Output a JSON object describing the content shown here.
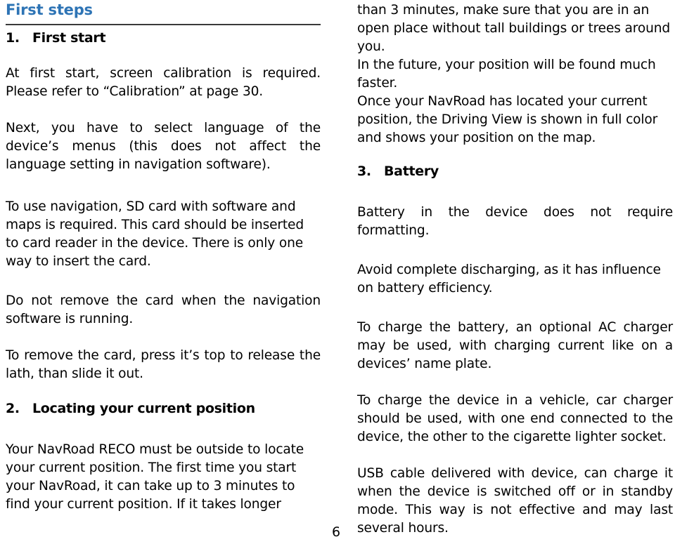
{
  "document": {
    "running_head": "First steps",
    "page_number": "6",
    "accent_color": "#2e74b5",
    "rule_color": "#3a3a3a",
    "text_color": "#000000"
  },
  "left_column": {
    "section_1": {
      "number": "1.",
      "title": "First start"
    },
    "paragraphs": {
      "p1": "At first start, screen calibration is required. Please refer to “Calibration” at page 30.",
      "p2": "Next, you have to select language of the device’s menus (this does not affect the language setting in navigation software).",
      "p3": "To use navigation, SD card with software and maps is required. This card should be inserted to card reader in the device. There is only one way to insert the card.",
      "p4": "Do not remove the card when the navigation software is running.",
      "p5": "To remove the card, press it’s top to release the lath, than slide it out.",
      "p6": "Your NavRoad RECO must be outside to locate your current position. The first time you start your NavRoad, it can take up to 3 minutes to find your current position. If it takes longer"
    },
    "section_2": {
      "number": "2.",
      "title": "Locating your current position"
    }
  },
  "right_column": {
    "paragraphs": {
      "p1": "than 3 minutes, make sure that you are in an open place without tall buildings or trees around you.",
      "p2": "In the future, your position will be found much faster.",
      "p3": "Once your NavRoad has located your current position, the Driving View is shown in full color and shows your position on the map.",
      "p4": "Battery in the device does not require formatting.",
      "p5": "Avoid complete discharging, as it has influence on battery efficiency.",
      "p6": "To charge the battery, an optional AC charger may be used, with charging current like on a devices’ name plate.",
      "p7": "To charge the device in a vehicle, car charger should be used, with one end connected to the device, the other to the cigarette lighter socket.",
      "p8": "USB cable delivered with device, can charge it when the device is switched off or in standby mode. This way is not effective and may last several hours."
    },
    "section_3": {
      "number": "3.",
      "title": "Battery"
    }
  }
}
